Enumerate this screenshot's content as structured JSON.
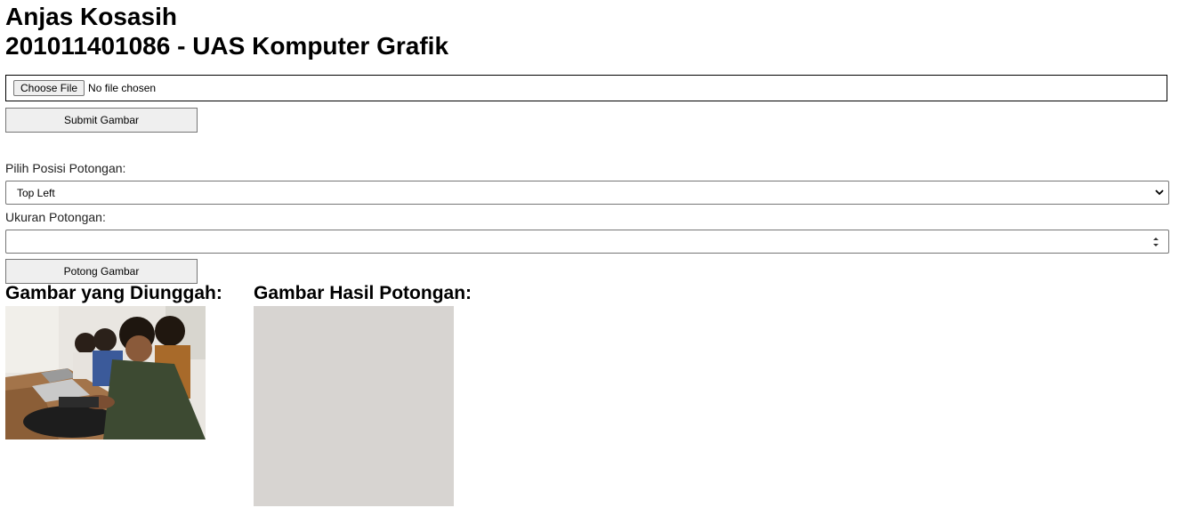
{
  "header": {
    "name": "Anjas Kosasih",
    "subtitle": "201011401086 - UAS Komputer Grafik"
  },
  "upload": {
    "choose_label": "Choose File",
    "status": "No file chosen",
    "submit_label": "Submit Gambar"
  },
  "crop": {
    "position_label": "Pilih Posisi Potongan:",
    "position_value": "Top Left",
    "size_label": "Ukuran Potongan:",
    "size_value": "",
    "cut_label": "Potong Gambar"
  },
  "results": {
    "uploaded_title": "Gambar yang Diunggah:",
    "cropped_title": "Gambar Hasil Potongan:"
  },
  "colors": {
    "crop_placeholder": "#d7d4d1"
  }
}
